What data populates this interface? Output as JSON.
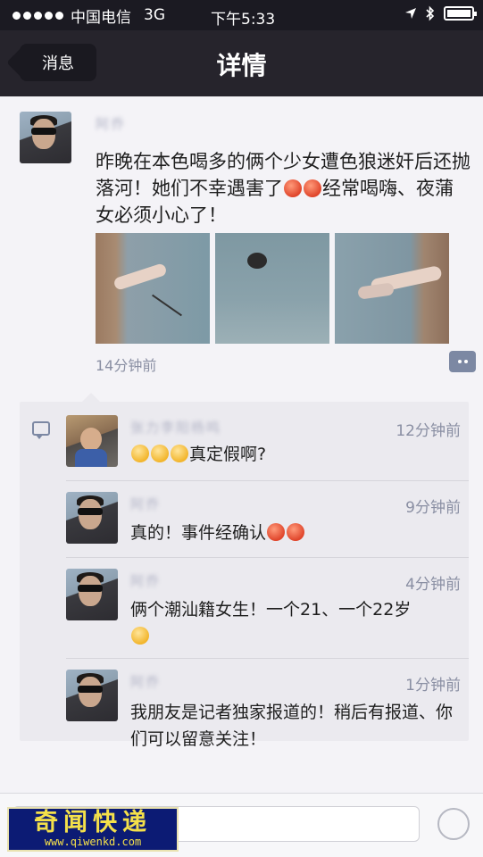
{
  "status_bar": {
    "carrier": "中国电信",
    "network": "3G",
    "time": "下午5:33"
  },
  "nav": {
    "back_label": "消息",
    "title": "详情"
  },
  "post": {
    "author": "阿乔",
    "text_parts": [
      "昨晚在本色喝多的俩个少女遭色狼迷奸后还抛落河！她们不幸遇害了",
      "经常喝嗨、夜蒲女必须小心了！"
    ],
    "time": "14分钟前"
  },
  "comments": [
    {
      "author": "张力李阳杨鸣",
      "text": "真定假啊?",
      "time": "12分钟前"
    },
    {
      "author": "阿乔",
      "text": "真的！事件经确认",
      "time": "9分钟前"
    },
    {
      "author": "阿乔",
      "text": "俩个潮汕籍女生！一个21、一个22岁",
      "time": "4分钟前"
    },
    {
      "author": "阿乔",
      "text": "我朋友是记者独家报道的！稍后有报道、你们可以留意关注！",
      "time": "1分钟前"
    }
  ],
  "watermark": {
    "title": "奇闻快递",
    "url": "www.qiwenkd.com"
  },
  "colors": {
    "nav_bg": "#26242c",
    "meta_blue": "#7c88a3",
    "watermark_bg": "#0c1b74",
    "watermark_text": "#f4e04a"
  }
}
